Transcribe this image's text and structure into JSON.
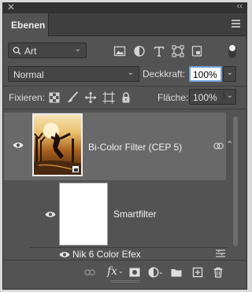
{
  "panel": {
    "tab_label": "Ebenen"
  },
  "filter": {
    "kind_value": "Art",
    "icons": [
      "image-icon",
      "adjustment-icon",
      "type-icon",
      "shape-icon",
      "smart-object-icon"
    ]
  },
  "blend": {
    "mode": "Normal",
    "opacity_label": "Deckkraft:",
    "opacity_value": "100%"
  },
  "lock": {
    "label": "Fixieren:",
    "fill_label": "Fläche:",
    "fill_value": "100%"
  },
  "layers": [
    {
      "name": "Bi-Color Filter (CEP 5)",
      "visible": true,
      "selected": true
    }
  ],
  "smart_filter": {
    "label": "Smartfilter",
    "items": [
      {
        "name": "Nik 6 Color Efex"
      }
    ]
  },
  "footer": {
    "icons": [
      "link-icon",
      "fx-icon",
      "mask-icon",
      "adjustment-layer-icon",
      "group-folder-icon",
      "new-layer-icon",
      "trash-icon"
    ],
    "fx_label": "fx"
  }
}
